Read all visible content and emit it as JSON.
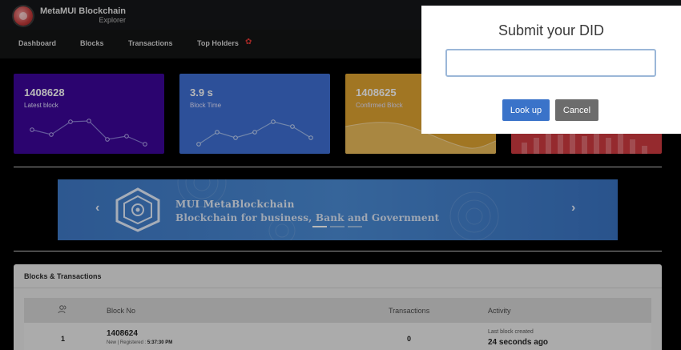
{
  "app": {
    "title": "MetaMUI Blockchain",
    "subtitle": "Explorer"
  },
  "nav": {
    "items": [
      "Dashboard",
      "Blocks",
      "Transactions",
      "Top Holders"
    ],
    "fire_icon": "fire-icon"
  },
  "cards": [
    {
      "value": "1408628",
      "label": "Latest block",
      "color": "#3c069a"
    },
    {
      "value": "3.9 s",
      "label": "Block Time",
      "color": "#3f6fd4"
    },
    {
      "value": "1408625",
      "label": "Confirmed Block",
      "color": "#e0a431"
    },
    {
      "value": "",
      "label": "",
      "color": "#cf3b41"
    }
  ],
  "banner": {
    "title": "MUI MetaBlockchain",
    "subtitle": "Blockchain for business, Bank and Government",
    "prev_icon": "chevron-left-icon",
    "next_icon": "chevron-right-icon"
  },
  "panel": {
    "title": "Blocks & Transactions",
    "columns": [
      "",
      "Block No",
      "Transactions",
      "Activity"
    ],
    "rows": [
      {
        "index": "1",
        "block_no": "1408624",
        "status": "New | Registered :",
        "time": "5:37:30 PM",
        "transactions": "0",
        "activity_label": "Last block created",
        "activity_value": "24 seconds ago"
      }
    ]
  },
  "modal": {
    "title": "Submit your DID",
    "input_value": "",
    "input_placeholder": "",
    "lookup_label": "Look up",
    "cancel_label": "Cancel",
    "lookup_color": "#3a73c9",
    "cancel_color": "#6c6c6c"
  }
}
